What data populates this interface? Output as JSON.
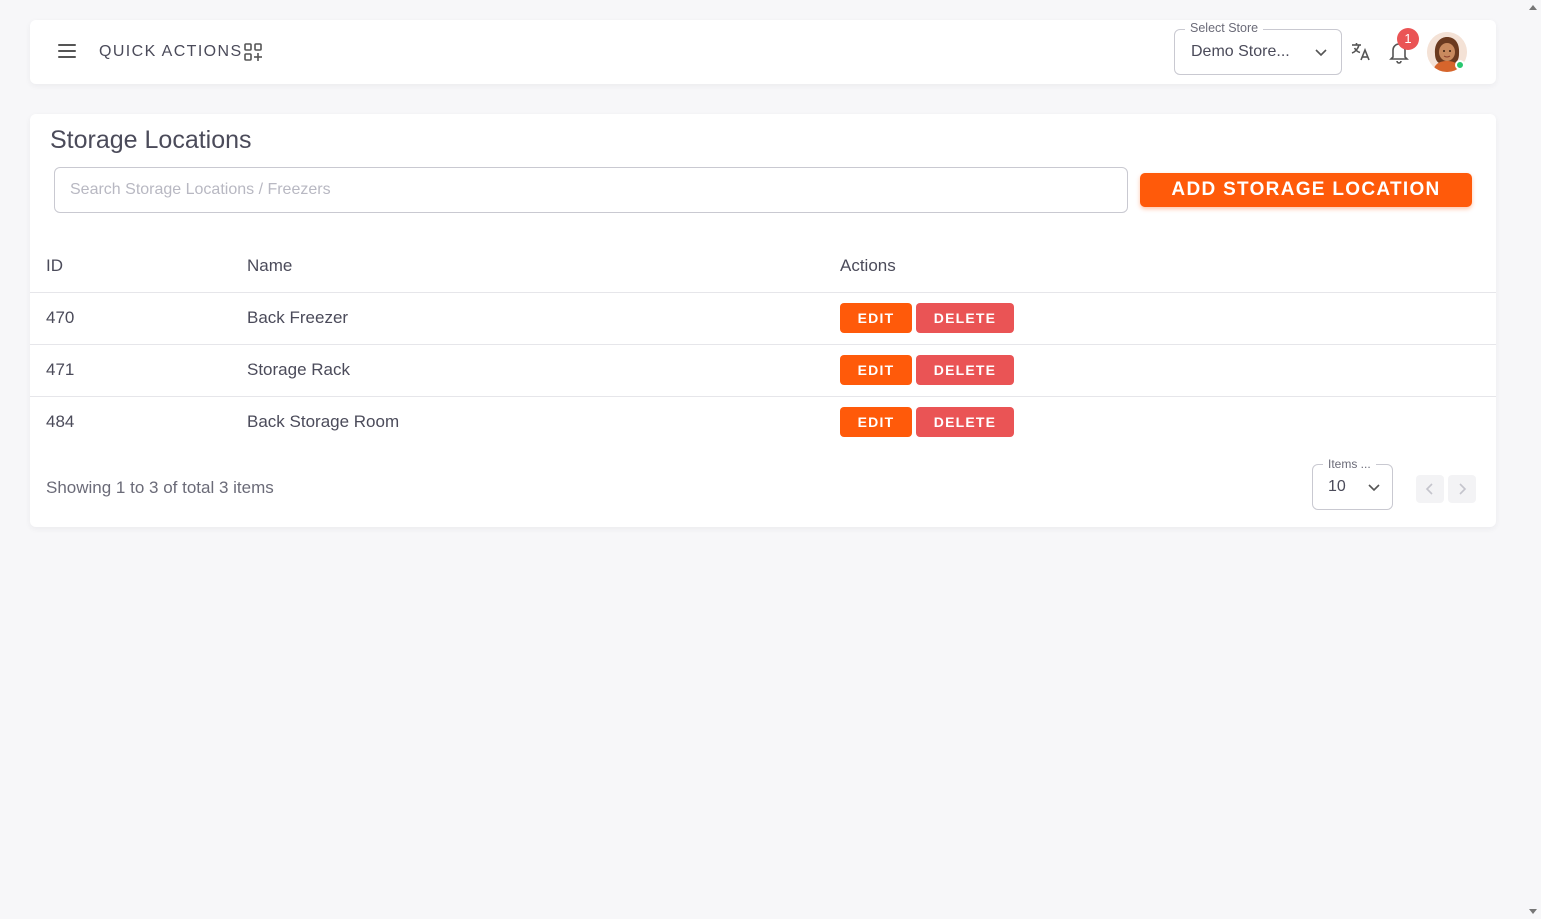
{
  "header": {
    "quick_actions_label": "QUICK ACTIONS",
    "store_select": {
      "legend": "Select Store",
      "value": "Demo Store..."
    },
    "notification_count": "1",
    "icons": [
      "menu-icon",
      "quick-actions-grid-icon",
      "chevron-down-icon",
      "translate-icon",
      "bell-icon",
      "avatar"
    ]
  },
  "page": {
    "title": "Storage Locations",
    "search_placeholder": "Search Storage Locations / Freezers",
    "add_button_label": "ADD STORAGE LOCATION"
  },
  "table": {
    "headers": {
      "id": "ID",
      "name": "Name",
      "actions": "Actions"
    },
    "rows": [
      {
        "id": "470",
        "name": "Back Freezer",
        "edit": "EDIT",
        "delete": "DELETE"
      },
      {
        "id": "471",
        "name": "Storage Rack",
        "edit": "EDIT",
        "delete": "DELETE"
      },
      {
        "id": "484",
        "name": "Back Storage Room",
        "edit": "EDIT",
        "delete": "DELETE"
      }
    ]
  },
  "pagination": {
    "summary": "Showing 1 to 3 of total 3 items",
    "per_page_legend": "Items ...",
    "per_page_value": "10"
  },
  "colors": {
    "primary": "#ff5a0a",
    "danger": "#ea5455",
    "online": "#28c76f",
    "background": "#f7f7f9"
  }
}
